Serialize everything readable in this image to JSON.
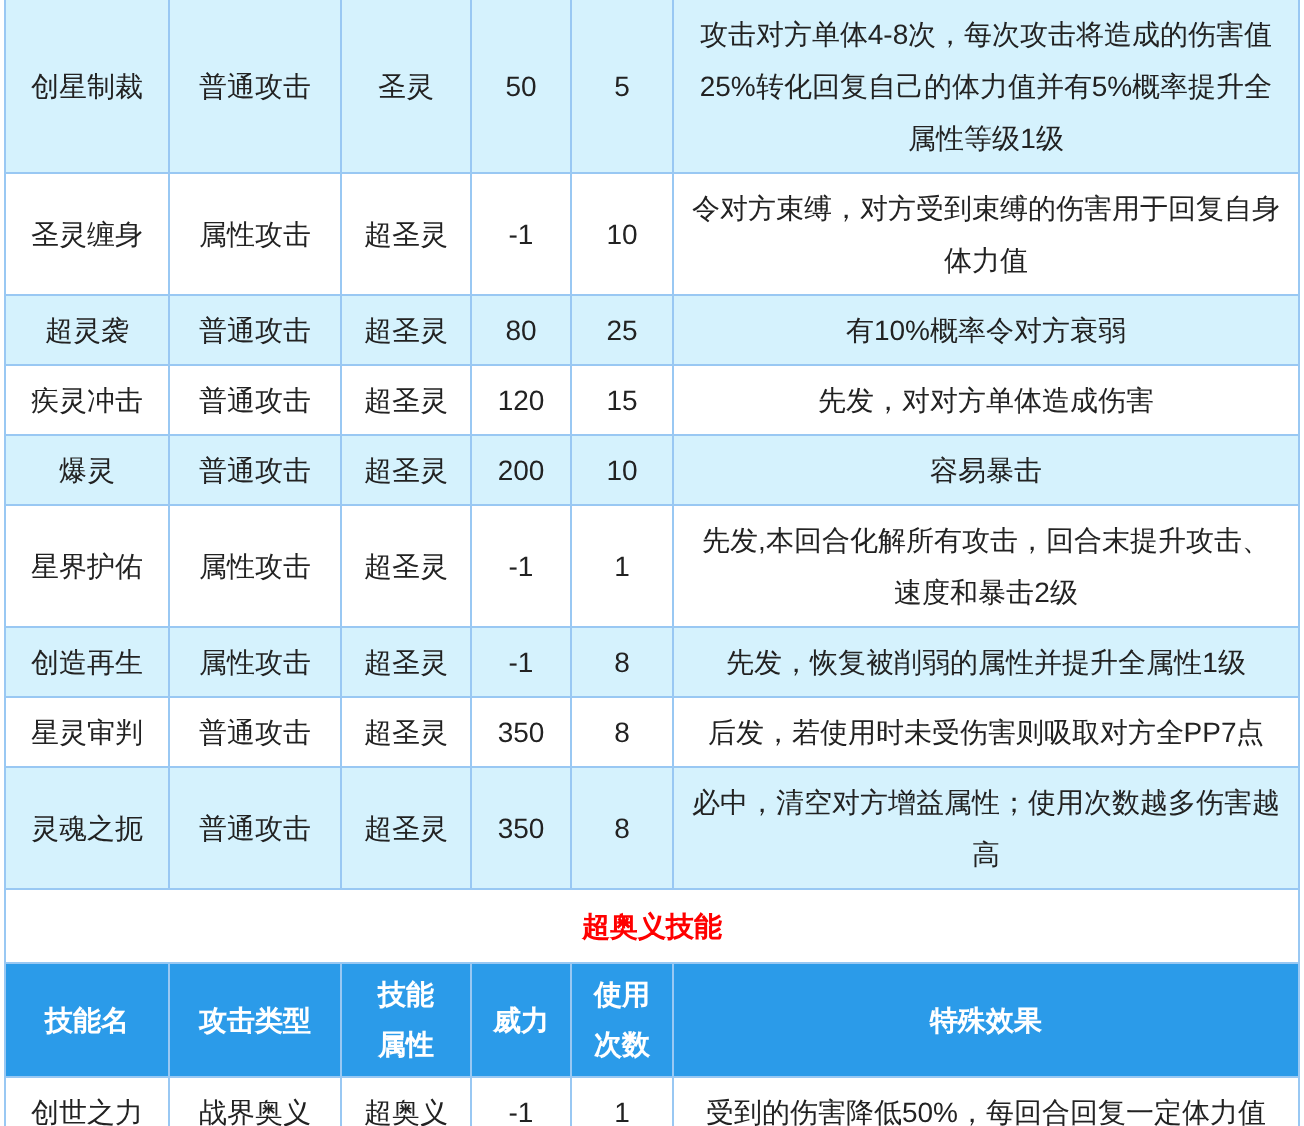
{
  "skills": [
    {
      "name": "创星制裁",
      "type": "普通攻击",
      "attribute": "圣灵",
      "power": "50",
      "pp": "5",
      "effect": "攻击对方单体4-8次，每次攻击将造成的伤害值25%转化回复自己的体力值并有5%概率提升全属性等级1级"
    },
    {
      "name": "圣灵缠身",
      "type": "属性攻击",
      "attribute": "超圣灵",
      "power": "-1",
      "pp": "10",
      "effect": "令对方束缚，对方受到束缚的伤害用于回复自身体力值"
    },
    {
      "name": "超灵袭",
      "type": "普通攻击",
      "attribute": "超圣灵",
      "power": "80",
      "pp": "25",
      "effect": "有10%概率令对方衰弱"
    },
    {
      "name": "疾灵冲击",
      "type": "普通攻击",
      "attribute": "超圣灵",
      "power": "120",
      "pp": "15",
      "effect": "先发，对对方单体造成伤害"
    },
    {
      "name": "爆灵",
      "type": "普通攻击",
      "attribute": "超圣灵",
      "power": "200",
      "pp": "10",
      "effect": "容易暴击"
    },
    {
      "name": "星界护佑",
      "type": "属性攻击",
      "attribute": "超圣灵",
      "power": "-1",
      "pp": "1",
      "effect": "先发,本回合化解所有攻击，回合末提升攻击、速度和暴击2级"
    },
    {
      "name": "创造再生",
      "type": "属性攻击",
      "attribute": "超圣灵",
      "power": "-1",
      "pp": "8",
      "effect": "先发，恢复被削弱的属性并提升全属性1级"
    },
    {
      "name": "星灵审判",
      "type": "普通攻击",
      "attribute": "超圣灵",
      "power": "350",
      "pp": "8",
      "effect": "后发，若使用时未受伤害则吸取对方全PP7点"
    },
    {
      "name": "灵魂之扼",
      "type": "普通攻击",
      "attribute": "超圣灵",
      "power": "350",
      "pp": "8",
      "effect": "必中，清空对方增益属性；使用次数越多伤害越高"
    }
  ],
  "section_title": "超奥义技能",
  "columns": [
    {
      "lines": [
        "技能名"
      ]
    },
    {
      "lines": [
        "攻击类型"
      ]
    },
    {
      "lines": [
        "技能",
        "属性"
      ]
    },
    {
      "lines": [
        "威力"
      ]
    },
    {
      "lines": [
        "使用",
        "次数"
      ]
    },
    {
      "lines": [
        "特殊效果"
      ]
    }
  ],
  "super_skills": [
    {
      "name": "创世之力",
      "type": "战界奥义",
      "attribute": "超奥义",
      "power": "-1",
      "pp": "1",
      "effect": "受到的伤害降低50%，每回合回复一定体力值"
    }
  ]
}
